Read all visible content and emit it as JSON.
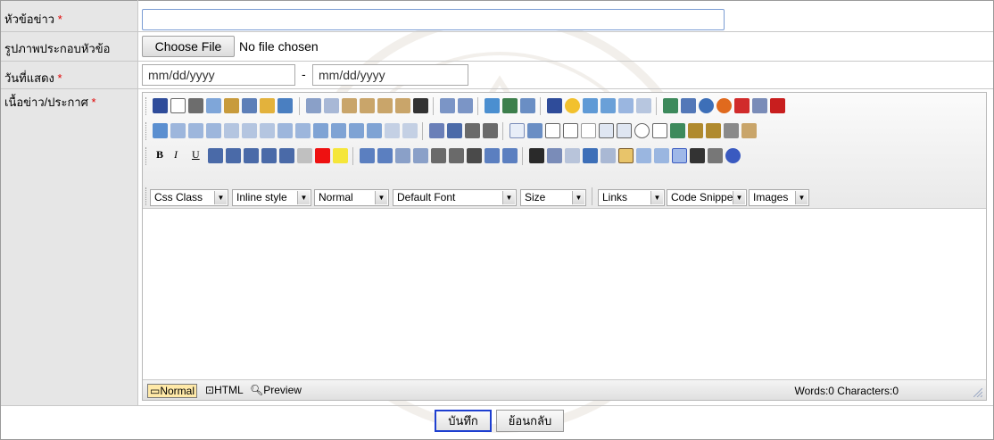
{
  "form": {
    "title_label": "หัวข้อข่าว",
    "image_label": "รูปภาพประกอบหัวข้อ",
    "date_label": "วันที่แสดง",
    "content_label": "เนื้อข่าว/ประกาศ",
    "required_mark": "*",
    "title_value": "",
    "file_button": "Choose File",
    "file_status": "No file chosen",
    "date_start": "mm/dd/yyyy",
    "date_end": "mm/dd/yyyy",
    "date_separator": "-"
  },
  "editor": {
    "format_bold": "B",
    "format_italic": "I",
    "format_underline": "U",
    "dropdowns": [
      "Css Class",
      "Inline style",
      "Normal",
      "Default Font",
      "Size",
      "Links",
      "Code Snippet",
      "Images"
    ],
    "modes": [
      "Normal",
      "HTML",
      "Preview"
    ],
    "word_count": "Words:0 Characters:0"
  },
  "actions": {
    "save": "บันทึก",
    "back": "ย้อนกลับ"
  },
  "colors": {
    "label_bg": "#e6e6e6",
    "required": "#e00000",
    "save_border": "#1e3fd0",
    "toolbar_bg": "#ececec"
  }
}
